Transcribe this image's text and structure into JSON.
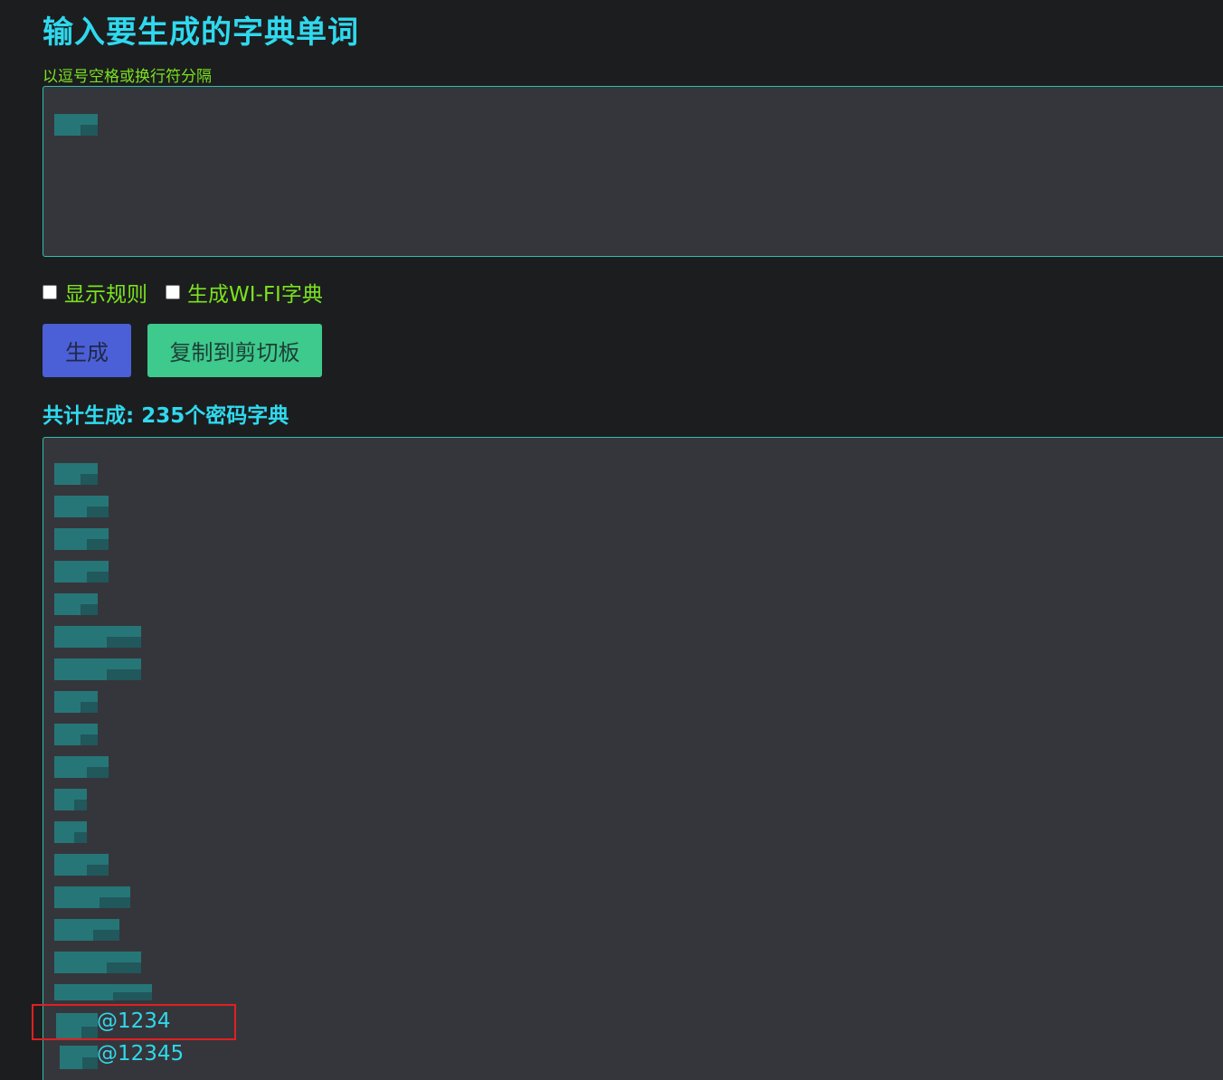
{
  "header": {
    "title": "输入要生成的字典单词",
    "hint": "以逗号空格或换行符分隔"
  },
  "options": {
    "show_rules": "显示规则",
    "wifi_dict": "生成WI-FI字典"
  },
  "buttons": {
    "generate": "生成",
    "copy": "复制到剪切板"
  },
  "result": {
    "count_text": "共计生成: 235个密码字典",
    "visible_lines": [
      "@1234",
      "@12345"
    ]
  },
  "colors": {
    "title": "#2fd9ee",
    "hint": "#7ae21f",
    "border": "#2fbfae",
    "generate_button": "#4b5fd6",
    "copy_button": "#3ec98d",
    "highlight_box": "#e02020"
  }
}
